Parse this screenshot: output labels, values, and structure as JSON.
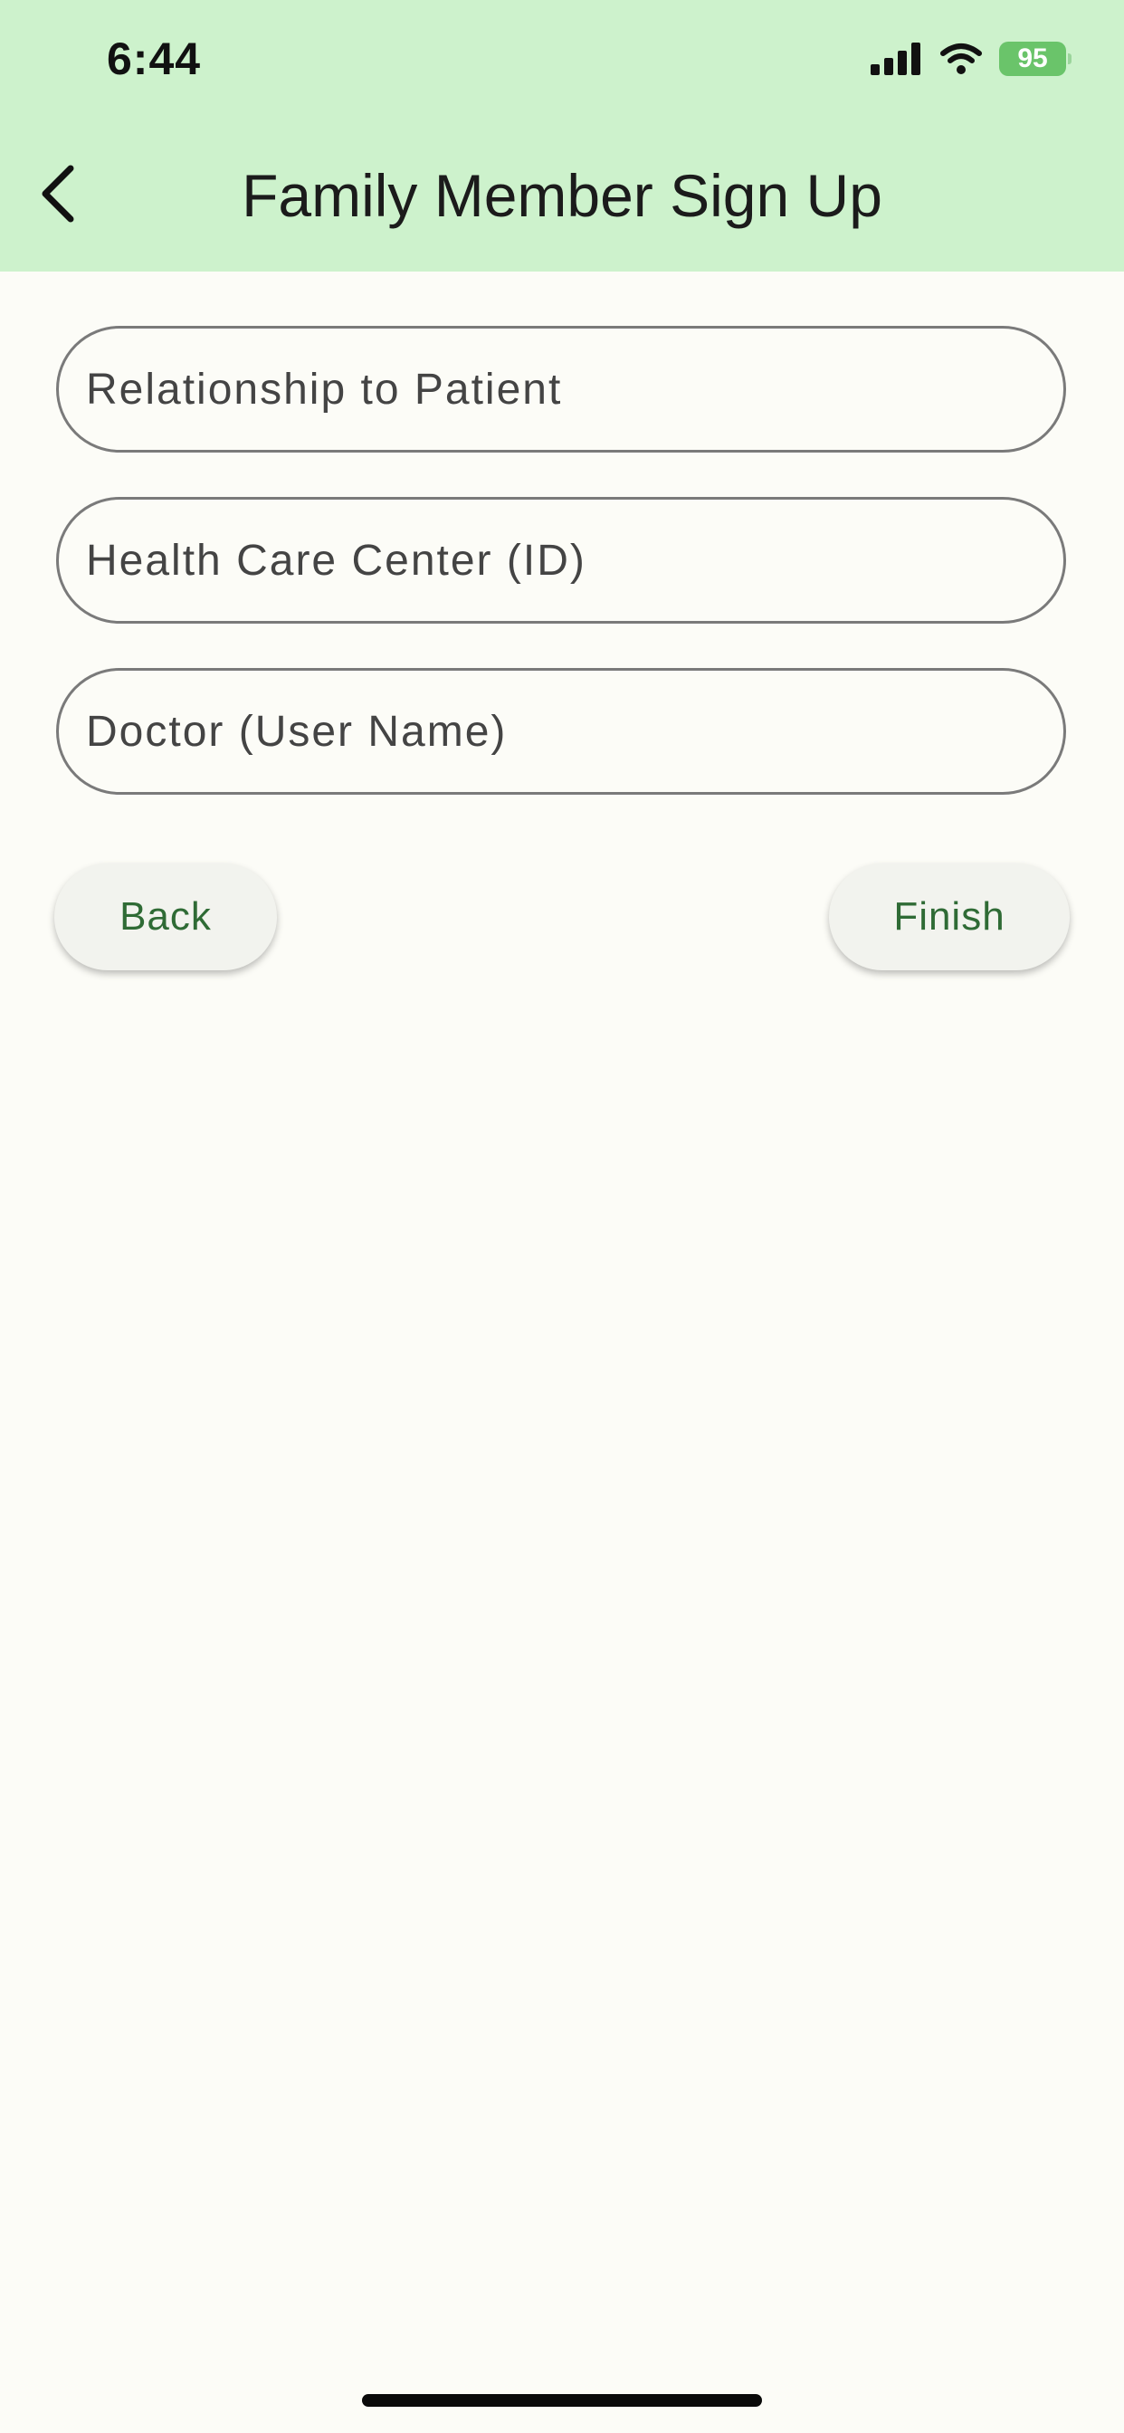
{
  "status_bar": {
    "time": "6:44",
    "battery": "95"
  },
  "header": {
    "title": "Family Member Sign Up"
  },
  "form": {
    "relationship_placeholder": "Relationship to Patient",
    "health_center_placeholder": "Health Care Center (ID)",
    "doctor_placeholder": "Doctor (User Name)"
  },
  "actions": {
    "back_label": "Back",
    "finish_label": "Finish"
  },
  "colors": {
    "header_bg": "#cdf2cc",
    "page_bg": "#fcfcf7",
    "accent_text": "#2f6b35"
  }
}
